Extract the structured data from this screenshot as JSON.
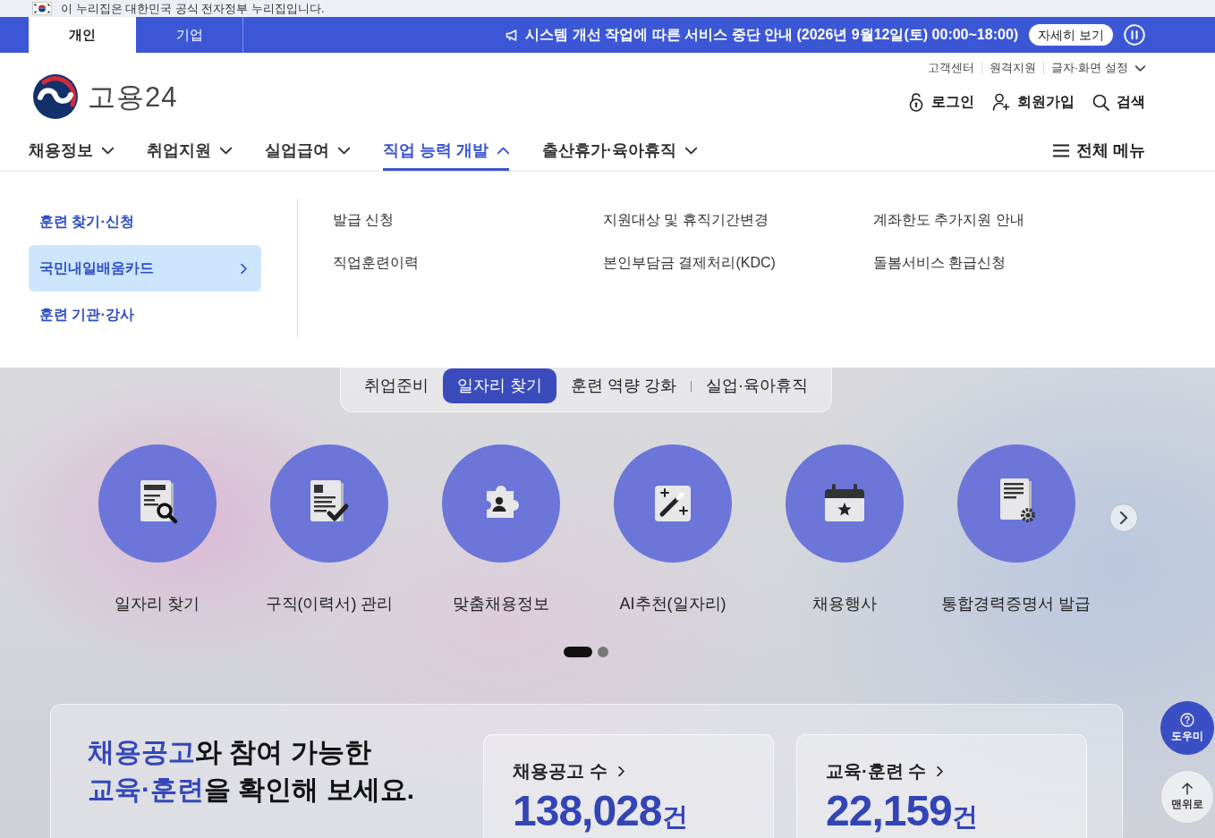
{
  "gov_banner": {
    "text": "이 누리집은 대한민국 공식 전자정부 누리집입니다."
  },
  "audience_tabs": [
    {
      "label": "개인",
      "selected": true
    },
    {
      "label": "기업",
      "selected": false
    }
  ],
  "notice": {
    "text": "시스템 개선 작업에 따른 서비스 중단 안내 (2026년 9월12일(토) 00:00~18:00)",
    "button": "자세히 보기"
  },
  "logo": {
    "text": "고용24"
  },
  "utility_links": [
    {
      "label": "고객센터",
      "kind": "link"
    },
    {
      "label": "원격지원",
      "kind": "link"
    },
    {
      "label": "글자·화면 설정",
      "kind": "menu"
    }
  ],
  "account_actions": [
    {
      "label": "로그인",
      "kind": "login"
    },
    {
      "label": "회원가입",
      "kind": "signup"
    },
    {
      "label": "검색",
      "kind": "search"
    }
  ],
  "main_nav": [
    {
      "label": "채용정보",
      "expanded": false
    },
    {
      "label": "취업지원",
      "expanded": false
    },
    {
      "label": "실업급여",
      "expanded": false
    },
    {
      "label": "직업 능력 개발",
      "expanded": true
    },
    {
      "label": "출산휴가·육아휴직",
      "expanded": false
    }
  ],
  "all_menu": {
    "label": "전체 메뉴"
  },
  "dropdown": {
    "sections": [
      {
        "label": "훈련 찾기·신청",
        "selected": false
      },
      {
        "label": "국민내일배움카드",
        "selected": true
      },
      {
        "label": "훈련 기관·강사",
        "selected": false
      }
    ],
    "links": [
      "발급 신청",
      "지원대상 및 휴직기간변경",
      "계좌한도 추가지원 안내",
      "직업훈련이력",
      "본인부담금 결제처리(KDC)",
      "돌봄서비스 환급신청"
    ]
  },
  "hero_tabs": [
    {
      "label": "취업준비",
      "selected": false
    },
    {
      "label": "일자리 찾기",
      "selected": true
    },
    {
      "label": "훈련 역량 강화",
      "selected": false
    },
    {
      "label": "실업·육아휴직",
      "selected": false
    }
  ],
  "quick_menu": [
    {
      "label": "일자리 찾기",
      "kind": "document-search"
    },
    {
      "label": "구직(이력서) 관리",
      "kind": "document-check"
    },
    {
      "label": "맞춤채용정보",
      "kind": "puzzle-person"
    },
    {
      "label": "AI추천(일자리)",
      "kind": "magic-wand"
    },
    {
      "label": "채용행사",
      "kind": "calendar-star"
    },
    {
      "label": "통합경력증명서 발급",
      "kind": "document-gear"
    }
  ],
  "pagination": [
    {
      "selected": true
    },
    {
      "selected": false
    }
  ],
  "stats_panel": {
    "heading": [
      [
        {
          "text": "채용공고",
          "highlight": true
        },
        {
          "text": "와 참여 가능한",
          "highlight": false
        }
      ],
      [
        {
          "text": "교육·훈련",
          "highlight": true
        },
        {
          "text": "을 확인해 보세요.",
          "highlight": false
        }
      ]
    ],
    "stats": [
      {
        "title": "채용공고 수",
        "value": "138,028",
        "unit": "건"
      },
      {
        "title": "교육·훈련 수",
        "value": "22,159",
        "unit": "건"
      }
    ]
  },
  "floating_buttons": [
    {
      "label": "도우미",
      "kind": "help"
    },
    {
      "label": "맨위로",
      "kind": "top"
    }
  ]
}
